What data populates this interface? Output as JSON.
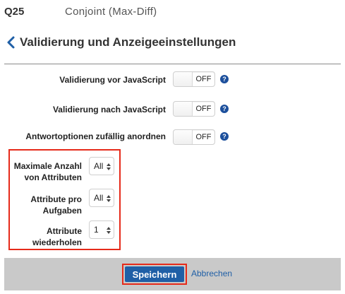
{
  "header": {
    "question_number": "Q25",
    "question_title": "Conjoint (Max-Diff)"
  },
  "panel": {
    "title": "Validierung und Anzeigeeinstellungen"
  },
  "toggles": [
    {
      "label": "Validierung vor JavaScript",
      "value": "OFF"
    },
    {
      "label": "Validierung nach JavaScript",
      "value": "OFF"
    },
    {
      "label": "Antwortoptionen zufällig anordnen",
      "value": "OFF"
    }
  ],
  "help_glyph": "?",
  "selects": [
    {
      "label_line1": "Maximale Anzahl",
      "label_line2": "von Attributen",
      "value": "All"
    },
    {
      "label_line1": "Attribute pro",
      "label_line2": "Aufgaben",
      "value": "All"
    },
    {
      "label_line1": "Attribute",
      "label_line2": "wiederholen",
      "value": "1"
    }
  ],
  "footer": {
    "save_label": "Speichern",
    "cancel_label": "Abbrechen"
  },
  "colors": {
    "accent": "#1f5fa6",
    "highlight": "#e62a1a",
    "footer_bg": "#c9c9c9"
  },
  "icons": {
    "back": "chevron-left-icon",
    "help": "help-circle-icon",
    "select_arrows": "updown-arrows-icon"
  }
}
